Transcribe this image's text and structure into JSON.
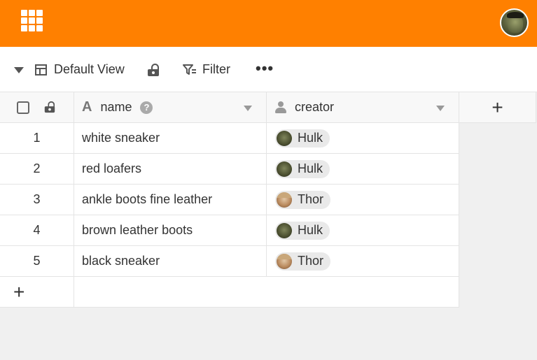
{
  "header": {
    "apps_icon": "grid-icon",
    "user_avatar": "hulk-avatar"
  },
  "toolbar": {
    "view_name": "Default View",
    "filter_label": "Filter",
    "more_label": "•••"
  },
  "table": {
    "columns": [
      {
        "name": "name",
        "type_icon": "text-type-icon"
      },
      {
        "name": "creator",
        "type_icon": "person-icon"
      }
    ],
    "add_column_label": "+",
    "add_row_label": "+",
    "rows": [
      {
        "index": "1",
        "name": "white sneaker",
        "creator": "Hulk"
      },
      {
        "index": "2",
        "name": "red loafers",
        "creator": "Hulk"
      },
      {
        "index": "3",
        "name": "ankle boots fine leather",
        "creator": "Thor"
      },
      {
        "index": "4",
        "name": "brown leather boots",
        "creator": "Hulk"
      },
      {
        "index": "5",
        "name": "black sneaker",
        "creator": "Thor"
      }
    ]
  },
  "colors": {
    "topbar": "#ff8000",
    "background": "#f0f0f0"
  }
}
